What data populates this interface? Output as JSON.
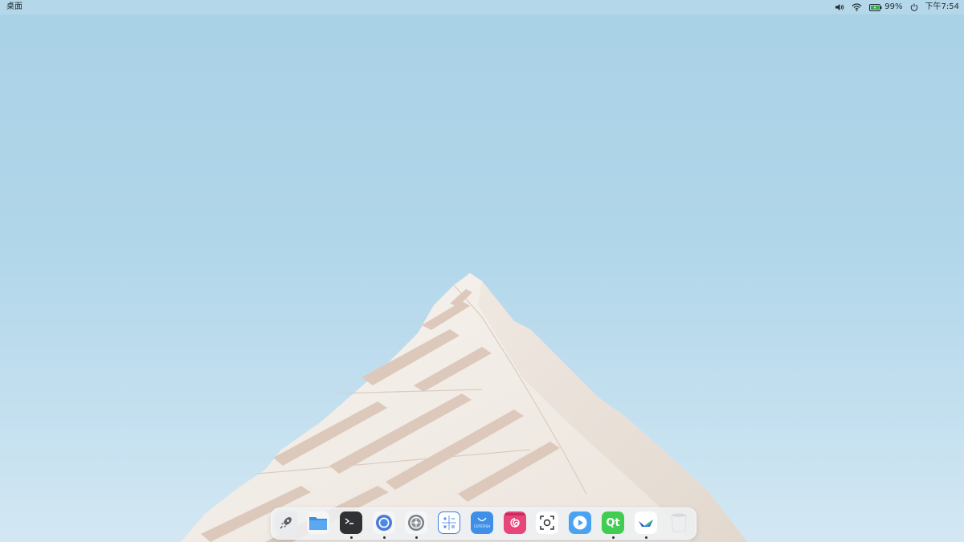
{
  "topbar": {
    "app_name": "桌面",
    "battery_percent": "99%",
    "clock": "下午7:54",
    "icons": {
      "volume": "volume-icon",
      "wifi": "wifi-icon",
      "battery": "battery-icon",
      "power": "power-icon"
    }
  },
  "dock": {
    "items": [
      {
        "name": "launcher",
        "icon": "rocket-icon",
        "running": false
      },
      {
        "name": "files",
        "icon": "folder-icon",
        "running": false
      },
      {
        "name": "terminal",
        "icon": "terminal-icon",
        "running": true
      },
      {
        "name": "browser",
        "icon": "chromium-icon",
        "running": true
      },
      {
        "name": "settings",
        "icon": "gear-icon",
        "running": true
      },
      {
        "name": "calculator",
        "icon": "calculator-icon",
        "running": false
      },
      {
        "name": "store",
        "icon": "store-icon",
        "label": "CUTEFISH",
        "running": false
      },
      {
        "name": "debian",
        "icon": "debian-icon",
        "running": false
      },
      {
        "name": "screenshot",
        "icon": "screenshot-icon",
        "running": false
      },
      {
        "name": "video-player",
        "icon": "play-icon",
        "running": false
      },
      {
        "name": "qt-creator",
        "icon": "qt-icon",
        "label": "Qt",
        "running": true
      },
      {
        "name": "bird-app",
        "icon": "bird-icon",
        "running": true
      },
      {
        "name": "trash",
        "icon": "trash-icon",
        "running": false
      }
    ]
  }
}
